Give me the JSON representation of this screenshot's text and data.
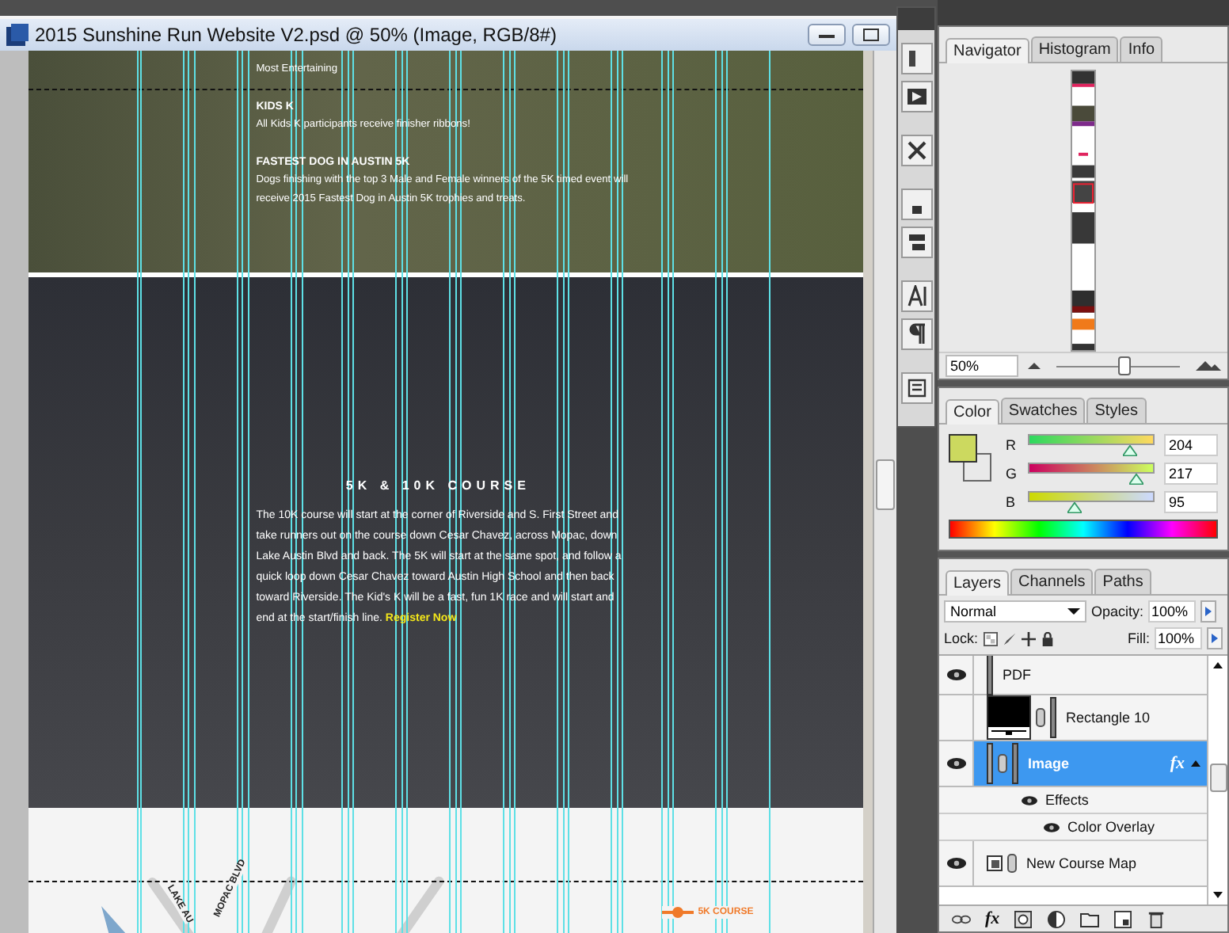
{
  "window": {
    "title": "2015 Sunshine Run Website V2.psd @ 50% (Image, RGB/8#)"
  },
  "awards": {
    "items": [
      {
        "kind": "text",
        "text": "Most Entertaining"
      },
      {
        "kind": "heading",
        "text": "KIDS K"
      },
      {
        "kind": "text",
        "text": "All Kids K participants receive finisher ribbons!"
      },
      {
        "kind": "heading",
        "text": "FASTEST DOG IN AUSTIN 5K"
      },
      {
        "kind": "text",
        "text": "Dogs finishing with the top 3 Male and Female winners of the 5K timed event will receive 2015 Fastest Dog in Austin 5K trophies and treats."
      }
    ]
  },
  "course": {
    "heading": "5K & 10K COURSE",
    "text": "The 10K course will start at the corner of Riverside and S. First Street and take runners out on the course down Cesar Chavez, across Mopac, down Lake Austin Blvd and back. The 5K will start at the same spot, and follow a quick loop down Cesar Chavez toward Austin High School and then back toward Riverside. The Kid's K will be a fast, fun 1K race and will start and end at the start/finish line.",
    "link": "Register Now"
  },
  "map": {
    "road_labels": [
      "LAKE AU",
      "MOPAC BLVD"
    ],
    "legend": "5K COURSE"
  },
  "navigator": {
    "tabs": [
      {
        "label": "Navigator",
        "selected": true
      },
      {
        "label": "Histogram",
        "selected": false
      },
      {
        "label": "Info",
        "selected": false
      }
    ],
    "zoom": "50%",
    "level": 0.55
  },
  "color": {
    "tabs": [
      {
        "label": "Color",
        "selected": true
      },
      {
        "label": "Swatches",
        "selected": false
      },
      {
        "label": "Styles",
        "selected": false
      }
    ],
    "channels": [
      {
        "name": "R",
        "value": "204",
        "level": 0.8
      },
      {
        "name": "G",
        "value": "217",
        "level": 0.85
      },
      {
        "name": "B",
        "value": "95",
        "level": 0.37
      }
    ]
  },
  "layers": {
    "tabs": [
      {
        "label": "Layers",
        "selected": true
      },
      {
        "label": "Channels",
        "selected": false
      },
      {
        "label": "Paths",
        "selected": false
      }
    ],
    "blend": "Normal",
    "opacity_label": "Opacity:",
    "opacity": "100%",
    "lock_label": "Lock:",
    "fill_label": "Fill:",
    "fill": "100%",
    "rows": [
      {
        "kind": "group",
        "name": "PDF",
        "visible": true,
        "selected": false
      },
      {
        "kind": "shape",
        "name": "Rectangle 10",
        "visible": false,
        "selected": false
      },
      {
        "kind": "image",
        "name": "Image",
        "visible": true,
        "selected": true,
        "fx": "fx"
      },
      {
        "kind": "effects",
        "name": "Effects",
        "visible": true
      },
      {
        "kind": "effect",
        "name": "Color Overlay",
        "visible": true
      },
      {
        "kind": "smart",
        "name": "New Course Map",
        "visible": true,
        "selected": false
      }
    ],
    "footer_fx": "fx"
  }
}
